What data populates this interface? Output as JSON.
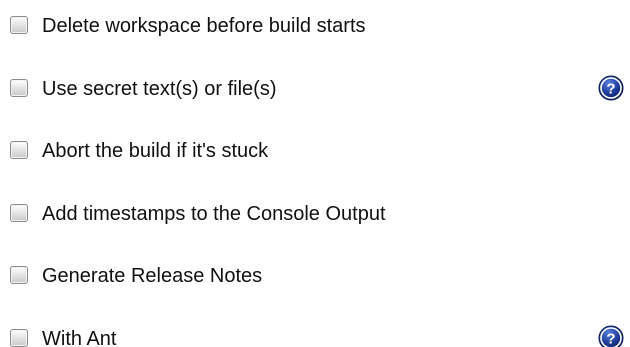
{
  "options": [
    {
      "label": "Delete workspace before build starts",
      "checked": false,
      "help": false
    },
    {
      "label": "Use secret text(s) or file(s)",
      "checked": false,
      "help": true,
      "help_icon": "help-icon"
    },
    {
      "label": "Abort the build if it's stuck",
      "checked": false,
      "help": false
    },
    {
      "label": "Add timestamps to the Console Output",
      "checked": false,
      "help": false
    },
    {
      "label": "Generate Release Notes",
      "checked": false,
      "help": false
    },
    {
      "label": "With Ant",
      "checked": false,
      "help": true,
      "help_icon": "help-icon"
    }
  ],
  "help_icon": {
    "glyph": "?",
    "color": "#1f3b9b"
  }
}
